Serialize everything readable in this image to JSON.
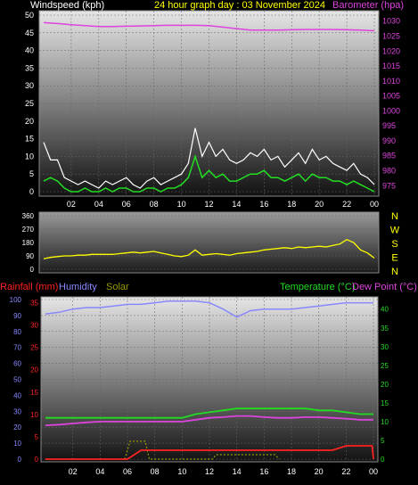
{
  "colors": {
    "background": "#000000",
    "wind": "#ffffff",
    "gust": "#22dd22",
    "barometer": "#dd44dd",
    "direction": "#ffff00",
    "rainfall": "#ff2222",
    "humidity": "#8888ff",
    "solar": "#999900",
    "temperature": "#22dd22",
    "dewpoint": "#dd44dd",
    "grid": "#666666",
    "axis_label": "#ffffff"
  },
  "header": {
    "windspeed_label": "Windspeed (kph)",
    "title": "24 hour graph day : 03 November 2024",
    "barometer_label": "Barometer (hpa)"
  },
  "bottom_header": {
    "rainfall_label": "Rainfall (mm)",
    "humidity_label": "Humidity",
    "solar_label": "Solar",
    "temperature_label": "Temperature (°C)",
    "dewpoint_label": "Dew Point (°C)"
  },
  "chart_data": [
    {
      "type": "line",
      "panel": "wind-barometer",
      "x_ticks": [
        "02",
        "04",
        "06",
        "08",
        "10",
        "12",
        "14",
        "16",
        "18",
        "20",
        "22",
        "00"
      ],
      "y_left_ticks": [
        "0",
        "5",
        "10",
        "15",
        "20",
        "25",
        "30",
        "35",
        "40",
        "45",
        "50"
      ],
      "y_left_range": [
        0,
        50
      ],
      "y_right_ticks": [
        "975",
        "980",
        "985",
        "990",
        "995",
        "1000",
        "1005",
        "1010",
        "1015",
        "1020",
        "1025",
        "1030"
      ],
      "y_right_range": [
        973,
        1032
      ],
      "x_range_hours": [
        0,
        24
      ],
      "series": [
        {
          "key": "wind",
          "x": [
            0,
            0.5,
            1,
            1.5,
            2,
            2.5,
            3,
            3.5,
            4,
            4.5,
            5,
            5.5,
            6,
            6.5,
            7,
            7.5,
            8,
            8.5,
            9,
            9.5,
            10,
            10.5,
            11,
            11.5,
            12,
            12.5,
            13,
            13.5,
            14,
            14.5,
            15,
            15.5,
            16,
            16.5,
            17,
            17.5,
            18,
            18.5,
            19,
            19.5,
            20,
            20.5,
            21,
            21.5,
            22,
            22.5,
            23,
            23.5,
            24
          ],
          "y": [
            14,
            9,
            9,
            4,
            3,
            2,
            3,
            2,
            1,
            3,
            2,
            3,
            4,
            2,
            1,
            3,
            4,
            2,
            3,
            4,
            5,
            8,
            18,
            10,
            14,
            10,
            12,
            9,
            8,
            9,
            11,
            10,
            12,
            9,
            10,
            7,
            9,
            11,
            8,
            12,
            9,
            10,
            8,
            7,
            6,
            8,
            5,
            4,
            2
          ]
        },
        {
          "key": "gust",
          "x": [
            0,
            0.5,
            1,
            1.5,
            2,
            2.5,
            3,
            3.5,
            4,
            4.5,
            5,
            5.5,
            6,
            6.5,
            7,
            7.5,
            8,
            8.5,
            9,
            9.5,
            10,
            10.5,
            11,
            11.5,
            12,
            12.5,
            13,
            13.5,
            14,
            14.5,
            15,
            15.5,
            16,
            16.5,
            17,
            17.5,
            18,
            18.5,
            19,
            19.5,
            20,
            20.5,
            21,
            21.5,
            22,
            22.5,
            23,
            23.5,
            24
          ],
          "y": [
            3,
            4,
            3,
            1,
            0,
            0,
            1,
            0,
            0,
            1,
            0,
            1,
            1,
            0,
            0,
            1,
            1,
            0,
            1,
            1,
            2,
            4,
            10,
            4,
            6,
            4,
            5,
            3,
            3,
            4,
            5,
            5,
            6,
            4,
            4,
            3,
            4,
            5,
            3,
            5,
            4,
            4,
            3,
            3,
            2,
            3,
            2,
            1,
            0
          ]
        },
        {
          "key": "barometer",
          "x": [
            0,
            1,
            2,
            3,
            4,
            5,
            6,
            7,
            8,
            9,
            10,
            11,
            12,
            13,
            14,
            15,
            16,
            17,
            18,
            19,
            20,
            21,
            22,
            23,
            24
          ],
          "y": [
            1029.5,
            1029.2,
            1028.8,
            1028.5,
            1028.2,
            1028.2,
            1028.3,
            1028.4,
            1028.5,
            1028.6,
            1028.6,
            1028.6,
            1028.5,
            1028.0,
            1027.5,
            1027.0,
            1027.0,
            1027.0,
            1027.1,
            1027.2,
            1027.2,
            1027.2,
            1027.1,
            1027.0,
            1026.8
          ]
        }
      ]
    },
    {
      "type": "line",
      "panel": "wind-direction",
      "x_range_hours": [
        0,
        24
      ],
      "y_left_ticks": [
        "360",
        "270",
        "180",
        "90",
        "0"
      ],
      "y_left_range": [
        0,
        360
      ],
      "compass_labels": [
        "N",
        "W",
        "S",
        "E",
        "N"
      ],
      "series": [
        {
          "key": "direction",
          "x": [
            0,
            0.5,
            1,
            1.5,
            2,
            2.5,
            3,
            3.5,
            4,
            4.5,
            5,
            5.5,
            6,
            6.5,
            7,
            7.5,
            8,
            8.5,
            9,
            9.5,
            10,
            10.5,
            11,
            11.5,
            12,
            12.5,
            13,
            13.5,
            14,
            14.5,
            15,
            15.5,
            16,
            16.5,
            17,
            17.5,
            18,
            18.5,
            19,
            19.5,
            20,
            20.5,
            21,
            21.5,
            22,
            22.5,
            23,
            23.5,
            24
          ],
          "y": [
            70,
            80,
            85,
            90,
            90,
            95,
            95,
            100,
            100,
            100,
            100,
            105,
            110,
            115,
            110,
            115,
            120,
            110,
            100,
            90,
            85,
            95,
            130,
            95,
            100,
            105,
            100,
            95,
            105,
            110,
            115,
            120,
            130,
            135,
            140,
            145,
            140,
            150,
            145,
            150,
            155,
            150,
            160,
            170,
            200,
            180,
            130,
            110,
            75
          ]
        }
      ]
    },
    {
      "type": "line",
      "panel": "rain-humidity-temperature",
      "x_ticks": [
        "02",
        "04",
        "06",
        "08",
        "10",
        "12",
        "14",
        "16",
        "18",
        "20",
        "22",
        "00"
      ],
      "x_range_hours": [
        0,
        24
      ],
      "y_humidity_ticks": [
        "0",
        "10",
        "20",
        "30",
        "40",
        "50",
        "60",
        "70",
        "80",
        "90",
        "100"
      ],
      "y_humidity_range": [
        0,
        100
      ],
      "y_rain_ticks": [
        "0",
        "5",
        "10",
        "15",
        "20",
        "25",
        "30",
        "35"
      ],
      "y_rain_range": [
        0,
        35
      ],
      "y_temp_ticks": [
        "0",
        "5",
        "10",
        "15",
        "20",
        "25",
        "30",
        "35",
        "40"
      ],
      "y_temp_range": [
        0,
        40
      ],
      "series": [
        {
          "key": "humidity",
          "x": [
            0,
            1,
            2,
            3,
            4,
            5,
            6,
            7,
            8,
            9,
            10,
            11,
            12,
            13,
            14,
            15,
            16,
            17,
            18,
            19,
            20,
            21,
            22,
            23,
            24
          ],
          "y": [
            91,
            92,
            94,
            95,
            95,
            96,
            97,
            97,
            98,
            99,
            99,
            99,
            98,
            94,
            89,
            93,
            94,
            94,
            94,
            95,
            96,
            97,
            98,
            98,
            98
          ]
        },
        {
          "key": "rainfall",
          "x": [
            0,
            1,
            2,
            3,
            4,
            5,
            6,
            6.5,
            7,
            7.5,
            8,
            9,
            10,
            11,
            12,
            13,
            14,
            15,
            16,
            17,
            18,
            19,
            20,
            21,
            22,
            23,
            23.9,
            24
          ],
          "y": [
            0,
            0,
            0,
            0,
            0,
            0,
            0,
            1,
            2,
            2,
            2,
            2,
            2,
            2,
            2,
            2,
            2,
            2,
            2,
            2,
            2,
            2,
            2,
            2,
            3,
            3,
            3,
            0
          ]
        },
        {
          "key": "solar",
          "x": [
            5.8,
            6.2,
            7.3,
            7.6,
            12.2,
            12.5,
            16.8,
            17.1
          ],
          "y": [
            0,
            4,
            4,
            0,
            0,
            1,
            1,
            0
          ]
        },
        {
          "key": "temperature",
          "x": [
            0,
            1,
            2,
            3,
            4,
            5,
            6,
            7,
            8,
            9,
            10,
            11,
            12,
            13,
            14,
            15,
            16,
            17,
            18,
            19,
            20,
            21,
            22,
            23,
            24
          ],
          "y": [
            11,
            11,
            11,
            11,
            11,
            11,
            11,
            11,
            11,
            11,
            11,
            12,
            12.5,
            13,
            13.5,
            13.5,
            13.5,
            13.5,
            13.5,
            13.5,
            13,
            13,
            12.5,
            12,
            12
          ]
        },
        {
          "key": "dewpoint",
          "x": [
            0,
            1,
            2,
            3,
            4,
            5,
            6,
            7,
            8,
            9,
            10,
            11,
            12,
            13,
            14,
            15,
            16,
            17,
            18,
            19,
            20,
            21,
            22,
            23,
            24
          ],
          "y": [
            9,
            9.2,
            9.5,
            9.8,
            10,
            10,
            10,
            10,
            10,
            10,
            10,
            10.5,
            11,
            11.2,
            11.5,
            11.5,
            11.2,
            11,
            11,
            11.2,
            11.2,
            11,
            10.8,
            10.5,
            10.5
          ]
        }
      ]
    }
  ]
}
